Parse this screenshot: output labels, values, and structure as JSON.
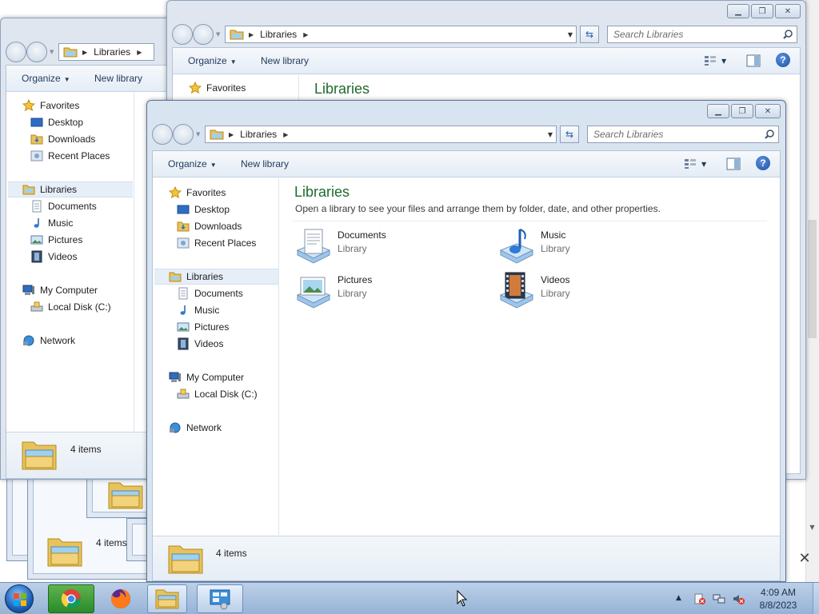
{
  "explorer": {
    "address_segment": "Libraries",
    "search_placeholder": "Search Libraries",
    "toolbar": {
      "organize": "Organize",
      "new_library": "New library"
    },
    "navigation": {
      "favorites": "Favorites",
      "desktop": "Desktop",
      "downloads": "Downloads",
      "recent_places": "Recent Places",
      "libraries": "Libraries",
      "documents": "Documents",
      "music": "Music",
      "pictures": "Pictures",
      "videos": "Videos",
      "my_computer": "My Computer",
      "local_disk": "Local Disk (C:)",
      "network": "Network"
    },
    "main": {
      "title": "Libraries",
      "subtitle": "Open a library to see your files and arrange them by folder, date, and other properties.",
      "libraries": [
        {
          "name": "Documents",
          "type": "Library",
          "icon": "documents-library-icon"
        },
        {
          "name": "Music",
          "type": "Library",
          "icon": "music-library-icon"
        },
        {
          "name": "Pictures",
          "type": "Library",
          "icon": "pictures-library-icon"
        },
        {
          "name": "Videos",
          "type": "Library",
          "icon": "videos-library-icon"
        }
      ]
    },
    "details": {
      "item_count": "4 items"
    }
  },
  "background": {
    "stack_item_count": "4 items"
  },
  "taskbar": {
    "apps": [
      "start-orb",
      "chrome-icon",
      "firefox-icon",
      "explorer-icon",
      "control-panel-icon"
    ],
    "clock_time": "4:09 AM",
    "clock_date": "8/8/2023"
  }
}
